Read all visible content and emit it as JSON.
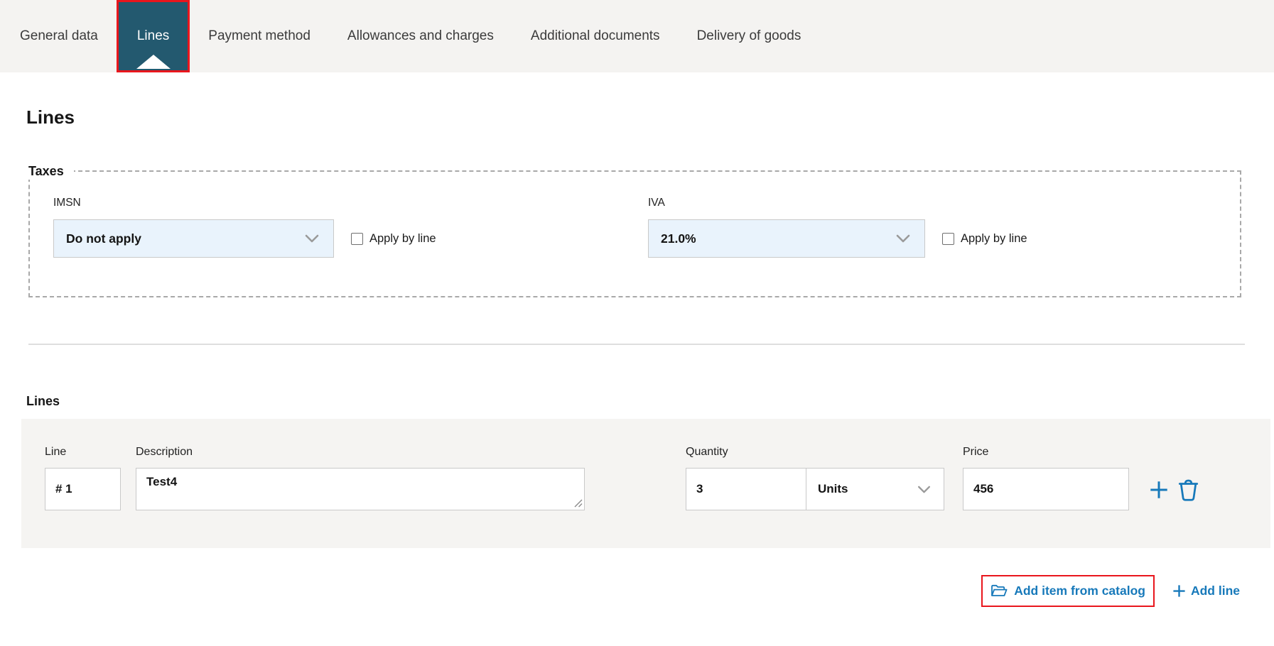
{
  "tab_bar": {
    "active_tab": "Lines",
    "tabs": [
      {
        "label": "General data"
      },
      {
        "label": "Lines"
      },
      {
        "label": "Payment method"
      },
      {
        "label": "Allowances and charges"
      },
      {
        "label": "Additional documents"
      },
      {
        "label": "Delivery of goods"
      }
    ]
  },
  "page": {
    "title": "Lines"
  },
  "taxes": {
    "legend": "Taxes",
    "imsn": {
      "label": "IMSN",
      "selected_value": "Do not apply",
      "checkbox_label": "Apply by line",
      "checked": false
    },
    "iva": {
      "label": "IVA",
      "selected_value": "21.0%",
      "checkbox_label": "Apply by line",
      "checked": false
    }
  },
  "lines_section": {
    "heading": "Lines",
    "columns": {
      "line": "Line",
      "description": "Description",
      "quantity": "Quantity",
      "price": "Price"
    },
    "rows": [
      {
        "line_number": "# 1",
        "description": "Test4",
        "quantity": "3",
        "unit": "Units",
        "price": "456"
      }
    ],
    "actions": {
      "add_item_from_catalog": "Add item from catalog",
      "add_line": "Add line"
    }
  },
  "icons": {
    "select_arrow": "chevron-down-icon",
    "row_add": "plus-icon",
    "row_delete": "trash-icon",
    "catalog": "folder-open-icon",
    "add_line": "plus-icon"
  },
  "colors": {
    "active_tab_bg": "#23596f",
    "annotation_red": "#e9161d",
    "link_blue": "#1779ba",
    "select_bg": "#e9f3fc",
    "tabbar_bg": "#f4f3f1",
    "panel_bg": "#f5f4f2"
  }
}
